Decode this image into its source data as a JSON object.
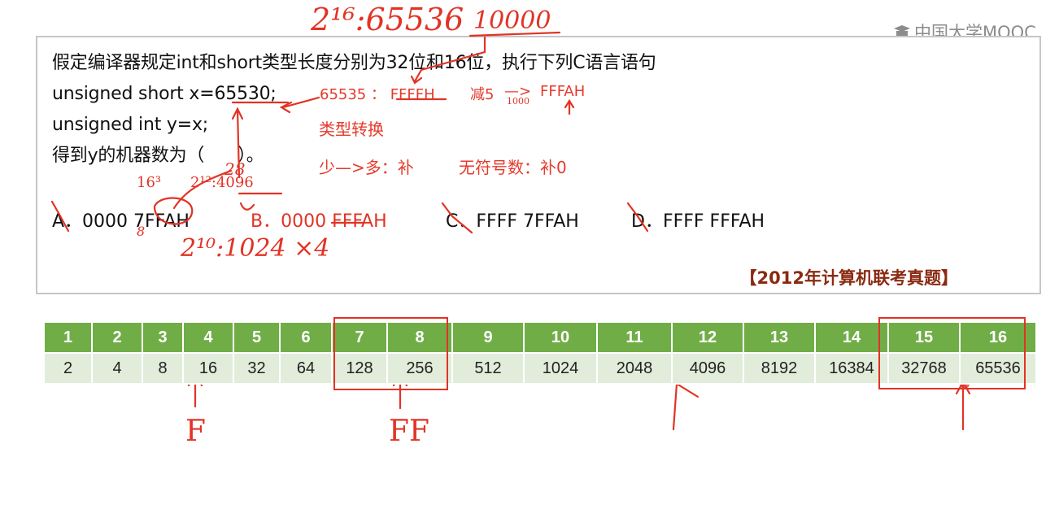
{
  "watermark": {
    "text": "中国大学MOOC"
  },
  "question": {
    "lines": [
      "假定编译器规定int和short类型长度分别为32位和16位，执行下列C语言语句",
      "unsigned short x=65530;",
      "unsigned int y=x;",
      "得到y的机器数为（      ）。"
    ],
    "options": {
      "a": "A．0000 7FFAH",
      "b": "B．0000 FFFAH",
      "c": "C．FFFF 7FFAH",
      "d": "D．FFFF FFFAH"
    },
    "source": "【2012年计算机联考真题】"
  },
  "annotations": {
    "typed": {
      "max": "65535 ： FFFFH",
      "minus5": "减5",
      "arrow": "—>",
      "result": "FFFAH",
      "type_conversion": "类型转换",
      "rule": "少—>多：补",
      "unsigned_rule": "无符号数：补0"
    },
    "handwritten": {
      "two_pow_16": "2¹⁶:65536",
      "hex_10000": "10000",
      "sixteen_cubed": "16³",
      "two_pow_12": "2¹²:4096",
      "twenty_eight": "28",
      "two_pow_10": "2¹⁰:1024 ×4",
      "small_num": "1000",
      "eight": "8",
      "f_label": "F",
      "ff_label": "FF"
    }
  },
  "powers_table": {
    "exponents": [
      "1",
      "2",
      "3",
      "4",
      "5",
      "6",
      "7",
      "8",
      "9",
      "10",
      "11",
      "12",
      "13",
      "14",
      "15",
      "16"
    ],
    "values": [
      "2",
      "4",
      "8",
      "16",
      "32",
      "64",
      "128",
      "256",
      "512",
      "1024",
      "2048",
      "4096",
      "8192",
      "16384",
      "32768",
      "65536"
    ],
    "header_color": "#70ad47",
    "row_color": "#e2ecdb",
    "highlight_color": "#e23325"
  }
}
